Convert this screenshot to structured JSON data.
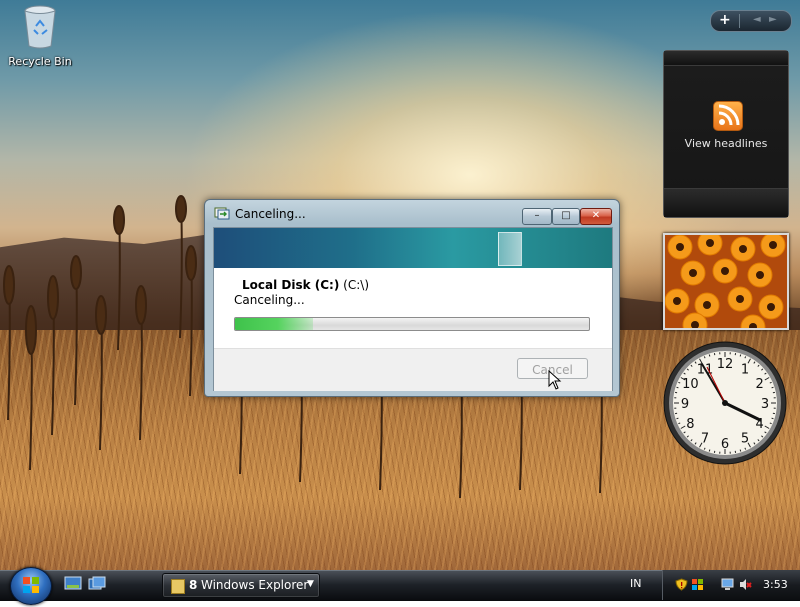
{
  "desktop": {
    "recycle_bin_label": "Recycle Bin"
  },
  "gadgets": {
    "controls": {
      "add_symbol": "+",
      "prev_symbol": "◄",
      "next_symbol": "►"
    },
    "feed": {
      "label": "View headlines",
      "icon": "rss-feed-icon"
    },
    "slideshow": {
      "icon": "flowers-photo"
    },
    "clock": {
      "numbers": [
        "12",
        "1",
        "2",
        "3",
        "4",
        "5",
        "6",
        "7",
        "8",
        "9",
        "10",
        "11"
      ]
    }
  },
  "dialog": {
    "title": "Canceling...",
    "controls": {
      "minimize": "–",
      "maximize": "□",
      "close": "✕"
    },
    "from_name": "Local Disk (C:)",
    "from_path": "(C:\\)",
    "status": "Canceling...",
    "progress_fraction": 0.22,
    "cancel_label": "Cancel",
    "cancel_enabled": false
  },
  "taskbar": {
    "explorer_group": {
      "count": "8",
      "label": "Windows Explorer"
    },
    "language": "IN",
    "time": "3:53"
  },
  "colors": {
    "progress_green": "#3fc24b",
    "close_red": "#c03a22",
    "banner_teal": "#2a9aa2"
  }
}
